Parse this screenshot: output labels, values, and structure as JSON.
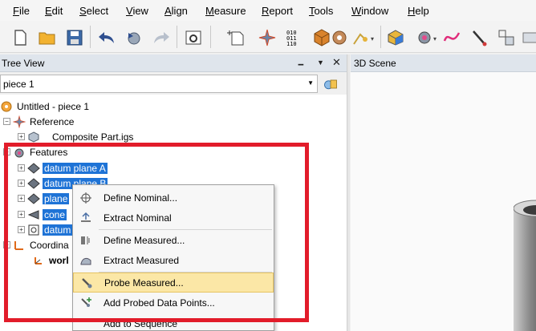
{
  "menu": [
    "File",
    "Edit",
    "Select",
    "View",
    "Align",
    "Measure",
    "Report",
    "Tools",
    "Window",
    "Help"
  ],
  "menu_mnemonics": [
    "F",
    "E",
    "S",
    "V",
    "A",
    "M",
    "R",
    "T",
    "W",
    "H"
  ],
  "tree_view": {
    "title": "Tree View",
    "combo_value": "piece 1",
    "items": {
      "root": "Untitled - piece 1",
      "reference": "Reference",
      "composite": "Composite Part.igs",
      "features": "Features",
      "f1": "datum plane A",
      "f2": "datum plane B",
      "f3": "plane",
      "f4": "cone",
      "f5": "datum",
      "coord": "Coordina",
      "world": "worl"
    }
  },
  "scene": {
    "title": "3D Scene"
  },
  "context_menu": {
    "items": [
      "Define Nominal...",
      "Extract Nominal",
      "Define Measured...",
      "Extract Measured",
      "Probe Measured...",
      "Add Probed Data Points...",
      "Add to Sequence"
    ],
    "highlighted_index": 4
  },
  "colors": {
    "selection": "#1e73d6",
    "highlight": "#fbe7a6",
    "annotation": "#e21c2a"
  }
}
